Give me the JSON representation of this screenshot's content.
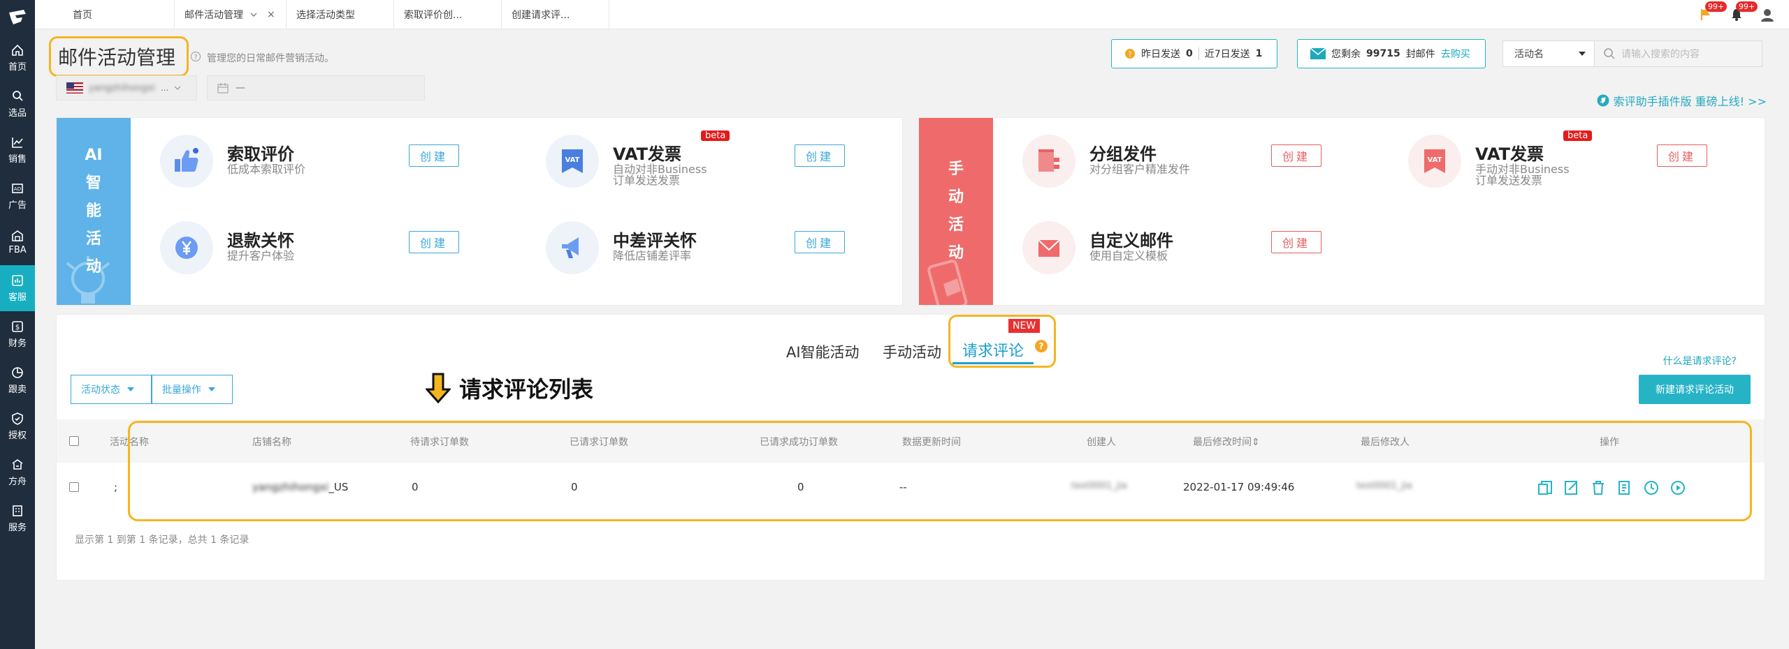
{
  "sidebar": {
    "items": [
      {
        "label": "首页",
        "icon": "home-icon"
      },
      {
        "label": "选品",
        "icon": "search-icon"
      },
      {
        "label": "销售",
        "icon": "chart-line-icon"
      },
      {
        "label": "广告",
        "icon": "ad-icon"
      },
      {
        "label": "FBA",
        "icon": "warehouse-icon"
      },
      {
        "label": "客服",
        "icon": "service-icon",
        "active": true
      },
      {
        "label": "财务",
        "icon": "dollar-icon"
      },
      {
        "label": "跟卖",
        "icon": "pie-icon"
      },
      {
        "label": "授权",
        "icon": "shield-icon"
      },
      {
        "label": "方舟",
        "icon": "ark-icon"
      },
      {
        "label": "服务",
        "icon": "building-icon"
      }
    ]
  },
  "tabs": [
    {
      "label": "首页"
    },
    {
      "label": "邮件活动管理"
    },
    {
      "label": "选择活动类型"
    },
    {
      "label": "索取评价创..."
    },
    {
      "label": "创建请求评..."
    }
  ],
  "top_badges": {
    "flag": "99+",
    "bell": "99+"
  },
  "header": {
    "title": "邮件活动管理",
    "desc": "管理您的日常邮件营销活动。",
    "store_name": "yangzhihongxi",
    "date_placeholder": "—"
  },
  "stats": {
    "yesterday_label": "昨日发送",
    "yesterday_value": "0",
    "week_label": "近7日发送",
    "week_value": "1",
    "remain_label": "您剩余",
    "remain_value": "99715",
    "remain_unit": "封邮件",
    "buy_label": "去购买"
  },
  "search": {
    "select_label": "活动名",
    "placeholder": "请输入搜索的内容"
  },
  "promo": "索评助手插件版 重磅上线! >>",
  "ai_panel": {
    "bar_label": "AI智能活动",
    "cards": [
      {
        "name": "索取评价",
        "desc": "低成本索取评价",
        "button": "创建"
      },
      {
        "name": "VAT发票",
        "desc": "自动对非Business订单发送发票",
        "button": "创建",
        "beta": "beta"
      },
      {
        "name": "退款关怀",
        "desc": "提升客户体验",
        "button": "创建"
      },
      {
        "name": "中差评关怀",
        "desc": "降低店铺差评率",
        "button": "创建"
      }
    ]
  },
  "manual_panel": {
    "bar_label": "手动活动",
    "cards": [
      {
        "name": "分组发件",
        "desc": "对分组客户精准发件",
        "button": "创建"
      },
      {
        "name": "VAT发票",
        "desc": "手动对非Business订单发送发票",
        "button": "创建",
        "beta": "beta"
      },
      {
        "name": "自定义邮件",
        "desc": "使用自定义模板",
        "button": "创建"
      }
    ]
  },
  "list": {
    "tabs": [
      "AI智能活动",
      "手动活动",
      "请求评论"
    ],
    "new_tag": "NEW",
    "what_link": "什么是请求评论?",
    "status_btn": "活动状态",
    "batch_btn": "批量操作",
    "annotation": "请求评论列表",
    "new_btn": "新建请求评论活动",
    "columns": [
      "活动名称",
      "店铺名称",
      "待请求订单数",
      "已请求订单数",
      "已请求成功订单数",
      "数据更新时间",
      "创建人",
      "最后修改时间",
      "最后修改人",
      "操作"
    ],
    "rows": [
      {
        "name": ";",
        "store": "yangzhihongxi_US",
        "pending": "0",
        "requested": "0",
        "success": "0",
        "updated": "--",
        "creator": "test0001_jia",
        "modified": "2022-01-17 09:49:46",
        "modifier": "test0001_jia"
      }
    ],
    "footer": "显示第 1 到第 1 条记录，总共 1 条记录"
  },
  "colors": {
    "accent": "#27b3c6",
    "sidebar": "#1f2d3d",
    "highlight": "#f5b521",
    "ai_bar": "#5fb3e8",
    "manual_bar": "#ef6b6b"
  }
}
